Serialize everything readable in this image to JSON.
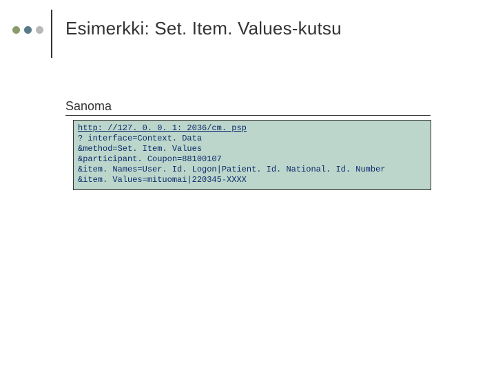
{
  "dots": {
    "colors": [
      "#8a9b6a",
      "#5a7a8a",
      "#b8b8b8"
    ]
  },
  "title": "Esimerkki: Set. Item. Values-kutsu",
  "subheading": "Sanoma",
  "code": {
    "url": "http: //127. 0. 0. 1: 2036/cm. psp",
    "lines": [
      "? interface=Context. Data",
      "&method=Set. Item. Values",
      "&participant. Coupon=88100107",
      "&item. Names=User. Id. Logon|Patient. Id. National. Id. Number",
      "&item. Values=mituomai|220345-XXXX"
    ]
  }
}
